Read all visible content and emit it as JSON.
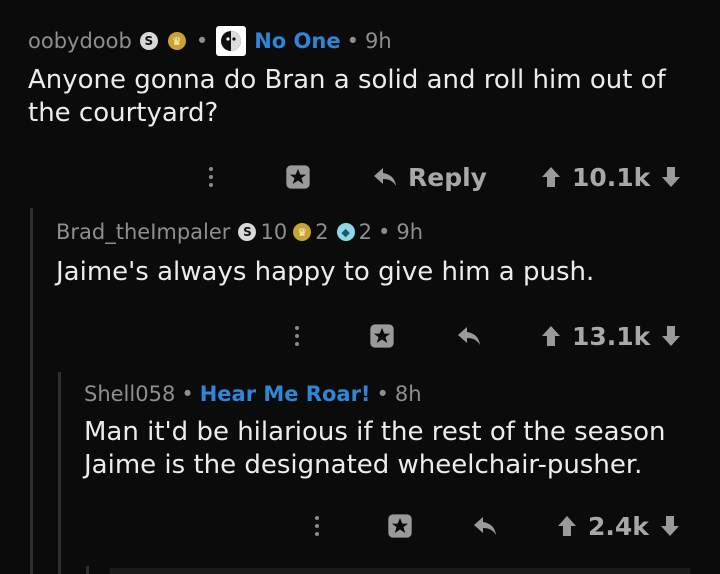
{
  "comments": [
    {
      "username": "oobydoob",
      "flair": "No One",
      "time": "9h",
      "body": "Anyone gonna do Bran a solid and roll him out of the courtyard?",
      "reply_label": "Reply",
      "score": "10.1k"
    },
    {
      "username": "Brad_theImpaler",
      "silver_count": "10",
      "gold_count": "2",
      "plat_count": "2",
      "time": "9h",
      "body": "Jaime's always happy to give him a push.",
      "score": "13.1k"
    },
    {
      "username": "Shell058",
      "flair": "Hear Me Roar!",
      "time": "8h",
      "body_line1": "Man it'd be hilarious if the rest of the season",
      "body_line2": "Jaime is the designated wheelchair-pusher.",
      "score": "2.4k"
    }
  ],
  "icons": {
    "silver_award": "S",
    "gold_award": "crown",
    "plat_award": "gem",
    "more": "vertical-dots",
    "award": "gift-star",
    "reply": "reply-arrow",
    "upvote": "arrow-up",
    "downvote": "arrow-down"
  },
  "colors": {
    "background": "#0b0b0b",
    "flair": "#2f86d6",
    "meta": "#8e8e8e"
  }
}
